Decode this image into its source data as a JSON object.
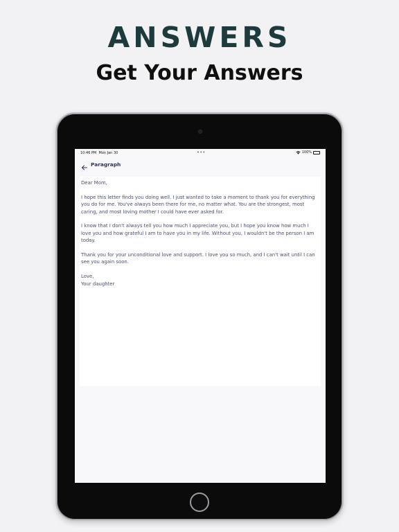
{
  "header": {
    "title": "ANSWERS",
    "subtitle": "Get Your Answers"
  },
  "status_bar": {
    "time": "10:46 PM",
    "date": "Mon Jan 30",
    "dots": "•••",
    "battery": "100%"
  },
  "nav": {
    "title": "Paragraph"
  },
  "letter": {
    "greeting": "Dear Mom,",
    "p1": "I hope this letter finds you doing well. I just wanted to take a moment to thank you for everything you do for me. You've always been there for me, no matter what. You are the strongest, most caring, and most loving mother I could have ever asked for.",
    "p2": "I know that I don't always tell you how much I appreciate you, but I hope you know how much I love you and how grateful I am to have you in my life. Without you, I wouldn't be the person I am today.",
    "p3": "Thank you for your unconditional love and support. I love you so much, and I can't wait until I can see you again soon.",
    "closing": "Love,",
    "signature": "Your daughter"
  },
  "icons": {
    "back": "arrow-left-icon",
    "wifi": "wifi-icon",
    "battery": "battery-icon"
  },
  "colors": {
    "background": "#f2f2f5",
    "headline": "#1d3a3d",
    "subheadline": "#0f0f0f",
    "letter_text": "#4a4f6e",
    "nav_title": "#2e3350"
  }
}
